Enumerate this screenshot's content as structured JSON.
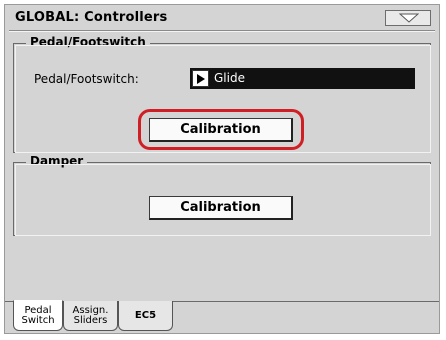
{
  "title": "GLOBAL: Controllers",
  "menu": {
    "icon": "dropdown-triangle-icon"
  },
  "pedal_section": {
    "legend": "Pedal/Footswitch",
    "field_label": "Pedal/Footswitch:",
    "field_value": "Glide",
    "arrow_icon": "play-arrow-icon",
    "calibration_label": "Calibration"
  },
  "damper_section": {
    "legend": "Damper",
    "calibration_label": "Calibration"
  },
  "tabs": [
    {
      "line1": "Pedal",
      "line2": "Switch",
      "active": true
    },
    {
      "line1": "Assign.",
      "line2": "Sliders",
      "active": false
    },
    {
      "line1": "EC5",
      "line2": "",
      "active": false
    }
  ],
  "colors": {
    "highlight": "#d01f24",
    "background": "#d4d4d4"
  }
}
